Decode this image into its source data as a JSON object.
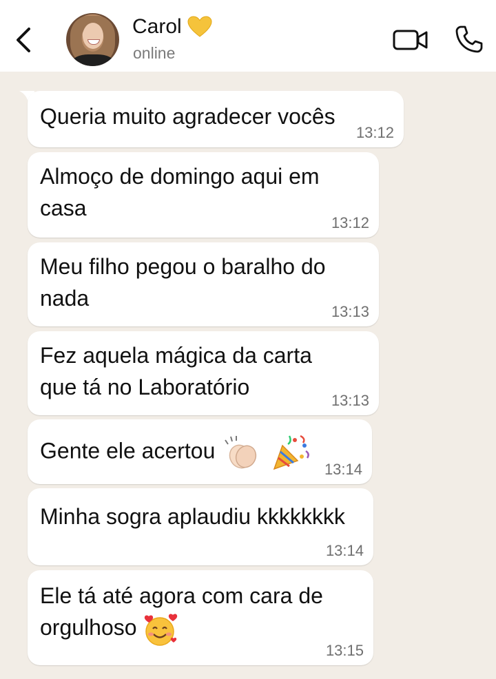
{
  "header": {
    "contact_name": "Carol",
    "status": "online"
  },
  "messages": [
    {
      "text": "Queria muito agradecer vocês",
      "time": "13:12"
    },
    {
      "text": "Almoço de domingo aqui em",
      "text2": "casa",
      "time": "13:12"
    },
    {
      "text": "Meu filho pegou o baralho do",
      "text2": "nada",
      "time": "13:13"
    },
    {
      "text": "Fez aquela mágica da carta",
      "text2": "que tá no Laboratório",
      "time": "13:13"
    },
    {
      "text": "Gente ele acertou",
      "emojis": [
        "clapping-hands",
        "party-popper"
      ],
      "time": "13:14"
    },
    {
      "text": "Minha sogra aplaudiu kkkkkkkk",
      "time": "13:14"
    },
    {
      "text": "Ele tá até agora com cara de",
      "text2": "orgulhoso",
      "emojis": [
        "smiling-face-with-hearts"
      ],
      "time": "13:15"
    }
  ],
  "colors": {
    "chat_background": "#f2ede6",
    "bubble": "#ffffff",
    "heart": "#f5c33b"
  }
}
